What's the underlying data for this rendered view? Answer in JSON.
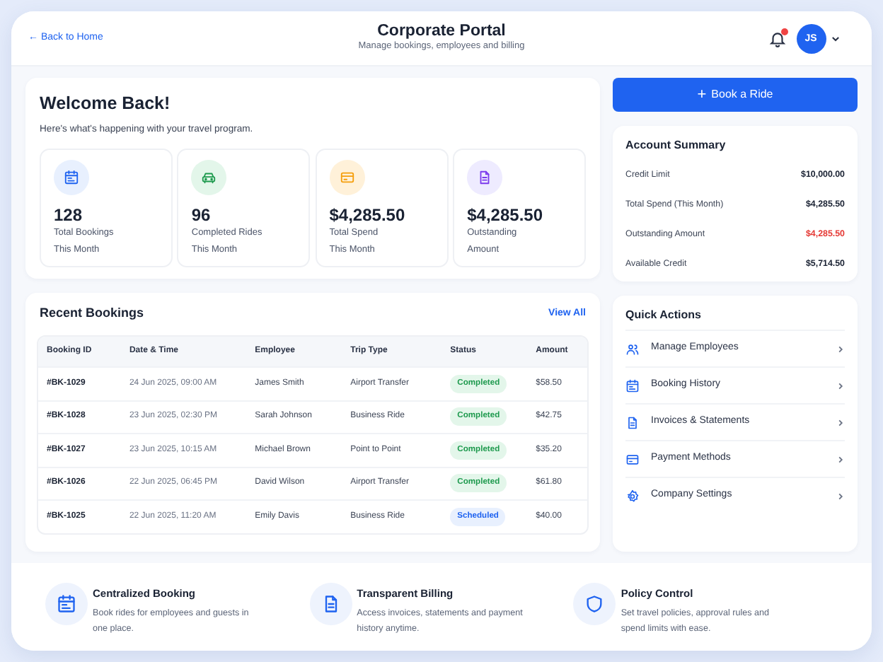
{
  "header": {
    "back_link": "← Back to Home",
    "title": "Corporate Portal",
    "subtitle": "Manage bookings, employees and billing",
    "notification_unread": true,
    "avatar": "JS"
  },
  "welcome": {
    "title": "Welcome Back!",
    "subtitle": "Here's what's happening with your travel program.",
    "stats": [
      {
        "kind": "calendar",
        "value": "128",
        "label": "Total Bookings",
        "period": "This Month"
      },
      {
        "kind": "car",
        "value": "96",
        "label": "Completed Rides",
        "period": "This Month"
      },
      {
        "kind": "card",
        "value": "$4,285.50",
        "label": "Total Spend",
        "period": "This Month"
      },
      {
        "kind": "document",
        "value": "$4,285.50",
        "label": "Outstanding",
        "period": "Amount"
      }
    ]
  },
  "recent_bookings": {
    "title": "Recent Bookings",
    "view_all": "View All",
    "columns": [
      "Booking ID",
      "Date & Time",
      "Employee",
      "Trip Type",
      "Status",
      "Amount"
    ],
    "rows": [
      {
        "id": "#BK-1029",
        "datetime": "24 Jun 2025, 09:00 AM",
        "employee": "James Smith",
        "trip_type": "Airport Transfer",
        "status": "Completed",
        "kind": "completed",
        "amount": "$58.50"
      },
      {
        "id": "#BK-1028",
        "datetime": "23 Jun 2025, 02:30 PM",
        "employee": "Sarah Johnson",
        "trip_type": "Business Ride",
        "status": "Completed",
        "kind": "completed",
        "amount": "$42.75"
      },
      {
        "id": "#BK-1027",
        "datetime": "23 Jun 2025, 10:15 AM",
        "employee": "Michael Brown",
        "trip_type": "Point to Point",
        "status": "Completed",
        "kind": "completed",
        "amount": "$35.20"
      },
      {
        "id": "#BK-1026",
        "datetime": "22 Jun 2025, 06:45 PM",
        "employee": "David Wilson",
        "trip_type": "Airport Transfer",
        "status": "Completed",
        "kind": "completed",
        "amount": "$61.80"
      },
      {
        "id": "#BK-1025",
        "datetime": "22 Jun 2025, 11:20 AM",
        "employee": "Emily Davis",
        "trip_type": "Business Ride",
        "status": "Scheduled",
        "kind": "scheduled",
        "amount": "$40.00"
      }
    ]
  },
  "book_button": {
    "icon": "+",
    "label": "Book a Ride"
  },
  "account_summary": {
    "title": "Account Summary",
    "rows": [
      {
        "label": "Credit Limit",
        "value": "$10,000.00",
        "alert": false
      },
      {
        "label": "Total Spend (This Month)",
        "value": "$4,285.50",
        "alert": false
      },
      {
        "label": "Outstanding Amount",
        "value": "$4,285.50",
        "alert": true
      },
      {
        "label": "Available Credit",
        "value": "$5,714.50",
        "alert": false
      }
    ]
  },
  "quick_actions": {
    "title": "Quick Actions",
    "items": [
      {
        "kind": "people",
        "label": "Manage Employees"
      },
      {
        "kind": "calendar",
        "label": "Booking History"
      },
      {
        "kind": "document",
        "label": "Invoices & Statements"
      },
      {
        "kind": "card",
        "label": "Payment Methods"
      },
      {
        "kind": "gear",
        "label": "Company Settings"
      }
    ]
  },
  "features": [
    {
      "kind": "calendar",
      "title": "Centralized Booking",
      "text": "Book rides for employees and guests in one place."
    },
    {
      "kind": "document",
      "title": "Transparent Billing",
      "text": "Access invoices, statements and payment history anytime."
    },
    {
      "kind": "shield",
      "title": "Policy Control",
      "text": "Set travel policies, approval rules and spend limits with ease."
    }
  ]
}
